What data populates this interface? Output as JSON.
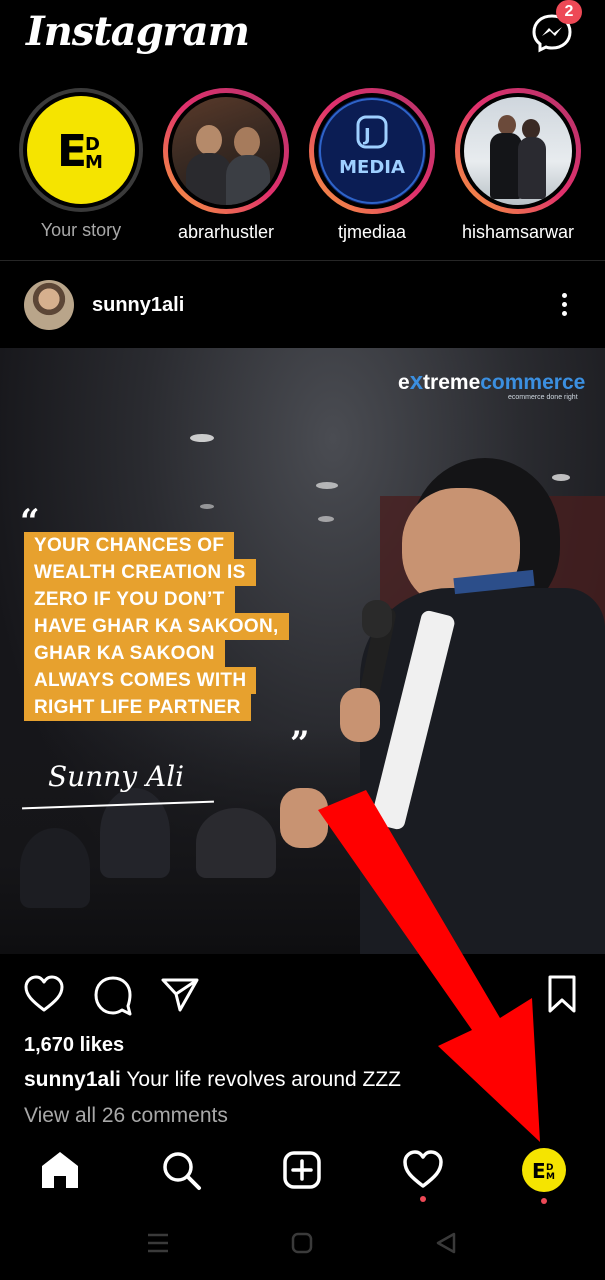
{
  "app": {
    "logo_text": "Instagram"
  },
  "header": {
    "messages_badge": "2"
  },
  "stories": [
    {
      "label": "Your story",
      "own": true
    },
    {
      "label": "abrarhustler"
    },
    {
      "label": "tjmediaa"
    },
    {
      "label": "hishamsarwar"
    }
  ],
  "story_logos": {
    "edm": "E",
    "tj": "MEDIA"
  },
  "post": {
    "username": "sunny1ali",
    "brand_main": "e",
    "brand_x": "x",
    "brand_treme": "treme",
    "brand_commerce": "commerce",
    "brand_sub": "ecommerce done right",
    "quote_lines": [
      "YOUR CHANCES OF",
      "WEALTH CREATION IS",
      "ZERO IF YOU DON’T",
      "HAVE GHAR KA SAKOON,",
      "GHAR KA SAKOON",
      "ALWAYS COMES WITH",
      "RIGHT LIFE PARTNER"
    ],
    "quote_open": "“",
    "quote_close": "”",
    "signature": "Sunny Ali",
    "likes": "1,670 likes",
    "caption_user": "sunny1ali",
    "caption_text": " Your life revolves around ZZZ",
    "view_comments": "View all 26 comments"
  },
  "colors": {
    "background": "#000000",
    "notification_red": "#ed4956",
    "quote_highlight": "#e7a12e",
    "edm_yellow": "#f5e400",
    "annotation_arrow": "#ff0000"
  }
}
